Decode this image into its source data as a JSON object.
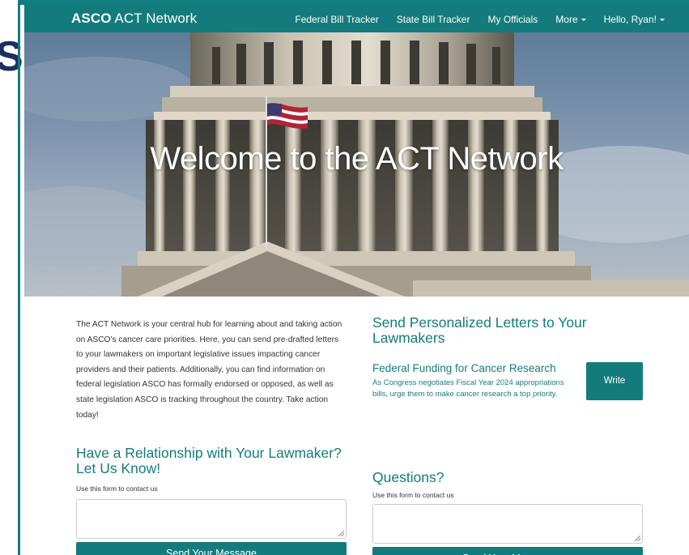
{
  "backdrop": {
    "glyph": "S"
  },
  "navbar": {
    "brand_bold": "ASCO",
    "brand_rest": " ACT Network",
    "links": [
      {
        "label": "Federal Bill Tracker"
      },
      {
        "label": "State Bill Tracker"
      },
      {
        "label": "My Officials"
      },
      {
        "label": "More"
      },
      {
        "label": "Hello, Ryan!"
      }
    ]
  },
  "hero": {
    "title": "Welcome to the ACT Network"
  },
  "intro": {
    "text": "The ACT Network is your central hub for learning about and taking action on ASCO's cancer care priorities. Here, you can send pre-drafted letters to your lawmakers on important legislative issues impacting cancer providers and their patients. Additionally, you can find information on federal legislation ASCO has formally endorsed or opposed, as well as state legislation ASCO is tracking throughout the country. Take action today!"
  },
  "relationship": {
    "heading": "Have a Relationship with Your Lawmaker? Let Us Know!",
    "label": "Use this form to contact us",
    "button": "Send Your Message"
  },
  "letters": {
    "heading": "Send Personalized Letters to Your Lawmakers",
    "item": {
      "title": "Federal Funding for Cancer Research",
      "description": "As Congress negotiates Fiscal Year 2024 appropriations bills, urge them to make cancer research a top priority.",
      "button": "Write"
    }
  },
  "questions": {
    "heading": "Questions?",
    "label": "Use this form to contact us",
    "button": "Send Your Message"
  },
  "colors": {
    "brand_teal": "#147b7c",
    "navy": "#1d2f5e"
  }
}
